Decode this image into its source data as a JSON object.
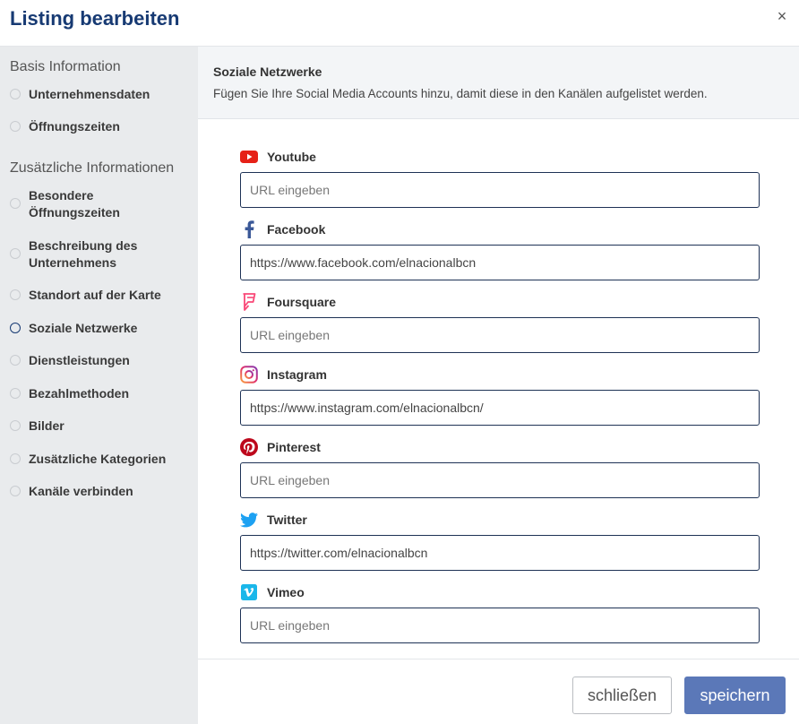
{
  "header": {
    "title": "Listing bearbeiten",
    "close_label": "×"
  },
  "sidebar": {
    "sections": [
      {
        "title": "Basis Information",
        "items": [
          {
            "label": "Unternehmensdaten"
          },
          {
            "label": "Öffnungszeiten"
          }
        ]
      },
      {
        "title": "Zusätzliche Informationen",
        "items": [
          {
            "label": "Besondere Öffnungszeiten"
          },
          {
            "label": "Beschreibung des Unternehmens"
          },
          {
            "label": "Standort auf der Karte"
          },
          {
            "label": "Soziale Netzwerke",
            "active": true
          },
          {
            "label": "Dienstleistungen"
          },
          {
            "label": "Bezahlmethoden"
          },
          {
            "label": "Bilder"
          },
          {
            "label": "Zusätzliche Kategorien"
          },
          {
            "label": "Kanäle verbinden"
          }
        ]
      }
    ]
  },
  "main": {
    "title": "Soziale Netzwerke",
    "description": "Fügen Sie Ihre Social Media Accounts hinzu, damit diese in den Kanälen aufgelistet werden.",
    "fields": [
      {
        "label": "Youtube",
        "icon": "youtube-icon",
        "value": "",
        "placeholder": "URL eingeben"
      },
      {
        "label": "Facebook",
        "icon": "facebook-icon",
        "value": "https://www.facebook.com/elnacionalbcn",
        "placeholder": "URL eingeben"
      },
      {
        "label": "Foursquare",
        "icon": "foursquare-icon",
        "value": "",
        "placeholder": "URL eingeben"
      },
      {
        "label": "Instagram",
        "icon": "instagram-icon",
        "value": "https://www.instagram.com/elnacionalbcn/",
        "placeholder": "URL eingeben"
      },
      {
        "label": "Pinterest",
        "icon": "pinterest-icon",
        "value": "",
        "placeholder": "URL eingeben"
      },
      {
        "label": "Twitter",
        "icon": "twitter-icon",
        "value": "https://twitter.com/elnacionalbcn",
        "placeholder": "URL eingeben"
      },
      {
        "label": "Vimeo",
        "icon": "vimeo-icon",
        "value": "",
        "placeholder": "URL eingeben"
      }
    ]
  },
  "footer": {
    "close_label": "schließen",
    "save_label": "speichern"
  },
  "colors": {
    "title": "#173a73",
    "save_button": "#5b78b8",
    "sidebar_bg": "#e9ebed",
    "youtube": "#e62117",
    "facebook": "#3b5998",
    "foursquare": "#f94877",
    "pinterest": "#bd081c",
    "twitter": "#1da1f2",
    "vimeo": "#1ab7ea"
  }
}
